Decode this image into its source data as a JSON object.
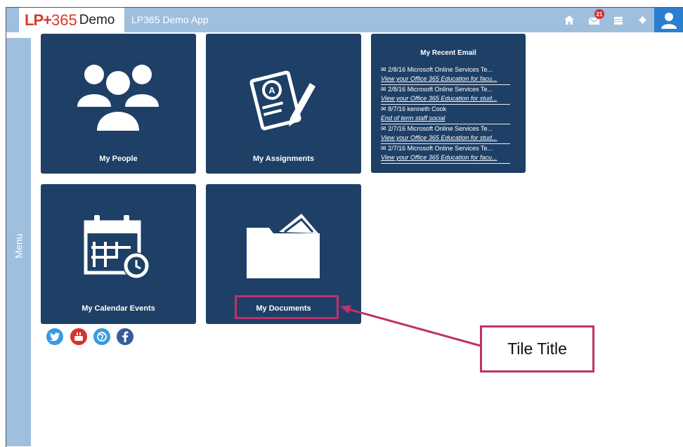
{
  "header": {
    "logo_lp": "LP+",
    "logo_num": "365",
    "logo_demo": "Demo",
    "app_title": "LP365 Demo App",
    "mail_count": "21",
    "icons": [
      "home-icon",
      "mail-icon",
      "calendar-icon",
      "gear-icon",
      "user-icon"
    ]
  },
  "sidebar": {
    "label": "Menu"
  },
  "tiles": [
    {
      "title": "My People",
      "icon": "people-icon"
    },
    {
      "title": "My Assignments",
      "icon": "assignment-icon"
    },
    {
      "title": "My Calendar Events",
      "icon": "calendar-clock-icon"
    },
    {
      "title": "My Documents",
      "icon": "folder-icon"
    }
  ],
  "email": {
    "title": "My Recent Email",
    "items": [
      {
        "header": "2/8/16 Microsoft Online Services Te...",
        "subject": "View your Office 365 Education for facu..."
      },
      {
        "header": "2/8/16 Microsoft Online Services Te...",
        "subject": "View your Office 365 Education for stud..."
      },
      {
        "header": "8/7/16 kenneth Cook",
        "subject": "End of term staff social"
      },
      {
        "header": "2/7/16 Microsoft Online Services Te...",
        "subject": "View your Office 365 Education for stud..."
      },
      {
        "header": "2/7/16 Microsoft Online Services Te...",
        "subject": "View your Office 365 Education for facu..."
      }
    ]
  },
  "social": [
    {
      "name": "twitter-icon",
      "color": "#3b9be0"
    },
    {
      "name": "youtube-icon",
      "color": "#d8322b"
    },
    {
      "name": "web-icon",
      "color": "#3b9be0"
    },
    {
      "name": "facebook-icon",
      "color": "#3a5b9a"
    }
  ],
  "annotation": {
    "callout_text": "Tile Title",
    "color": "#c0306b"
  }
}
